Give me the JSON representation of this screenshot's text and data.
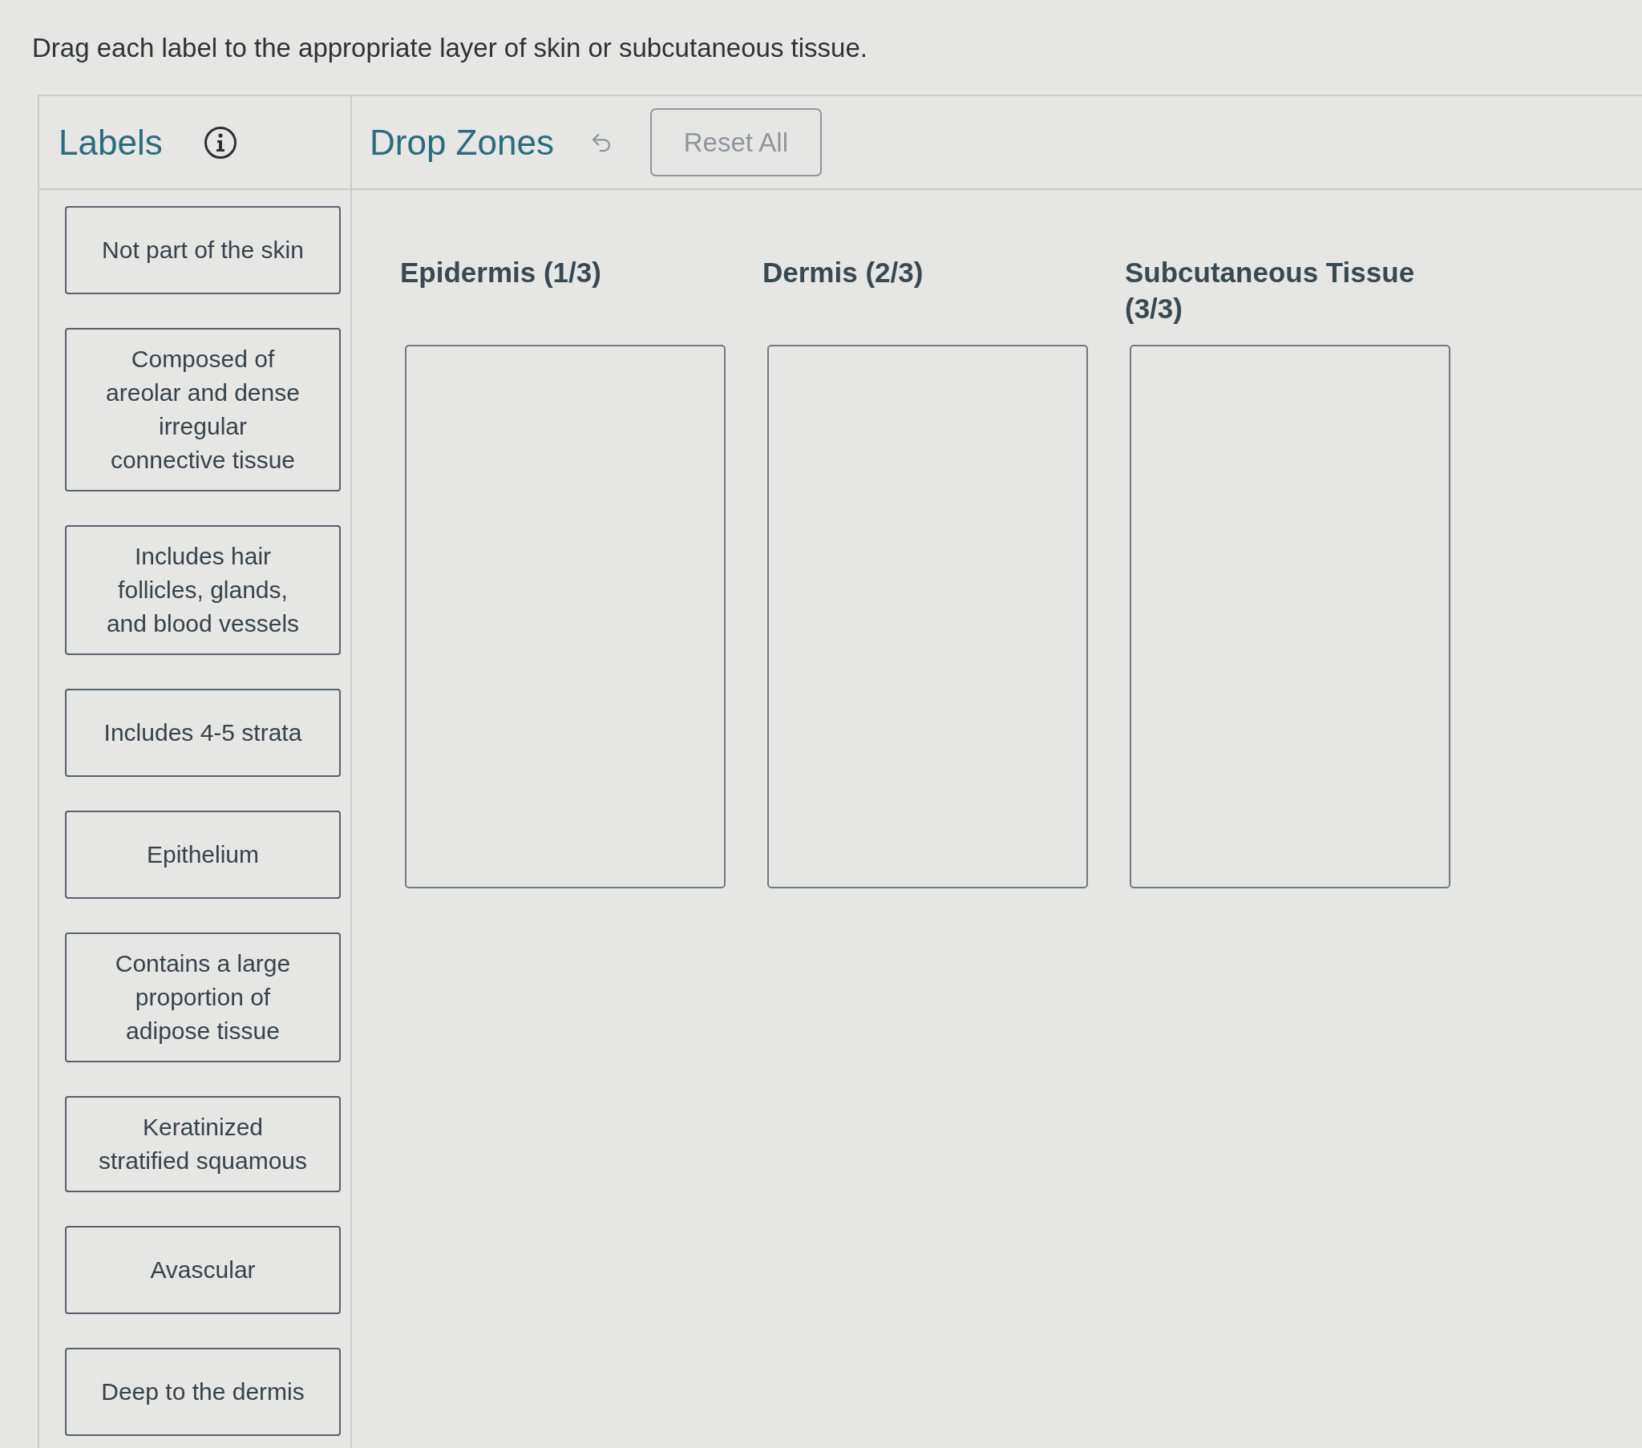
{
  "instruction": "Drag each label to the appropriate layer of skin or subcutaneous tissue.",
  "labels_panel": {
    "title": "Labels",
    "labels": [
      "Not part of the skin",
      "Composed of areolar and dense irregular connective tissue",
      "Includes hair follicles, glands, and blood vessels",
      "Includes 4-5 strata",
      "Epithelium",
      "Contains a large proportion of adipose tissue",
      "Keratinized stratified squamous",
      "Avascular",
      "Deep to the dermis"
    ]
  },
  "drop_zones_panel": {
    "title": "Drop Zones",
    "reset_button": {
      "label": "Reset All",
      "disabled": true
    },
    "zones": [
      {
        "title": "Epidermis (1/3)"
      },
      {
        "title": "Dermis (2/3)"
      },
      {
        "title": "Subcutaneous Tissue (3/3)"
      }
    ]
  }
}
